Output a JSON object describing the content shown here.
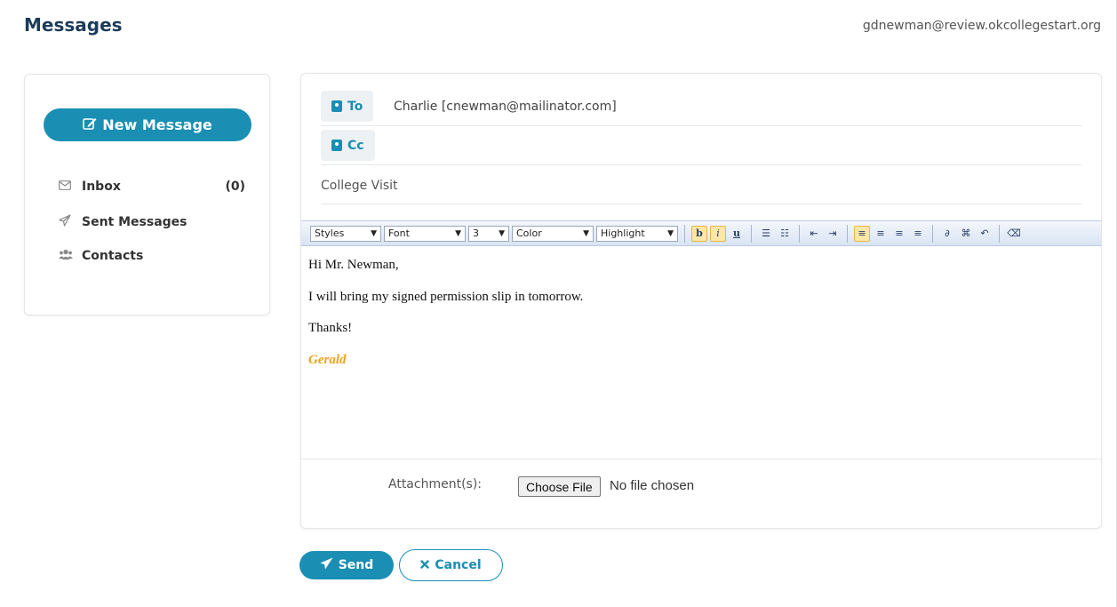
{
  "header": {
    "title": "Messages",
    "user_email": "gdnewman@review.okcollegestart.org"
  },
  "sidebar": {
    "new_message_label": "New Message",
    "items": [
      {
        "label": "Inbox",
        "count": "(0)",
        "icon": "envelope-icon"
      },
      {
        "label": "Sent Messages",
        "icon": "paper-plane-icon"
      },
      {
        "label": "Contacts",
        "icon": "users-icon"
      }
    ]
  },
  "compose": {
    "to_label": "To",
    "to_value": "Charlie [cnewman@mailinator.com]",
    "cc_label": "Cc",
    "subject": "College Visit",
    "toolbar": {
      "styles": "Styles",
      "font": "Font",
      "size": "3",
      "color": "Color",
      "highlight": "Highlight",
      "bold": "b",
      "italic": "i",
      "underline": "u"
    },
    "body": {
      "greeting": "Hi Mr. Newman,",
      "line1": "I will bring my signed permission slip in tomorrow.",
      "line2": "Thanks!",
      "signature": "Gerald"
    },
    "attachments_label": "Attachment(s):",
    "choose_file_label": "Choose File",
    "file_status": "No file chosen"
  },
  "actions": {
    "send_label": "Send",
    "cancel_label": "Cancel"
  },
  "colors": {
    "accent": "#1a8fb3",
    "title": "#1c3b5a",
    "signature": "#f0a21c"
  }
}
